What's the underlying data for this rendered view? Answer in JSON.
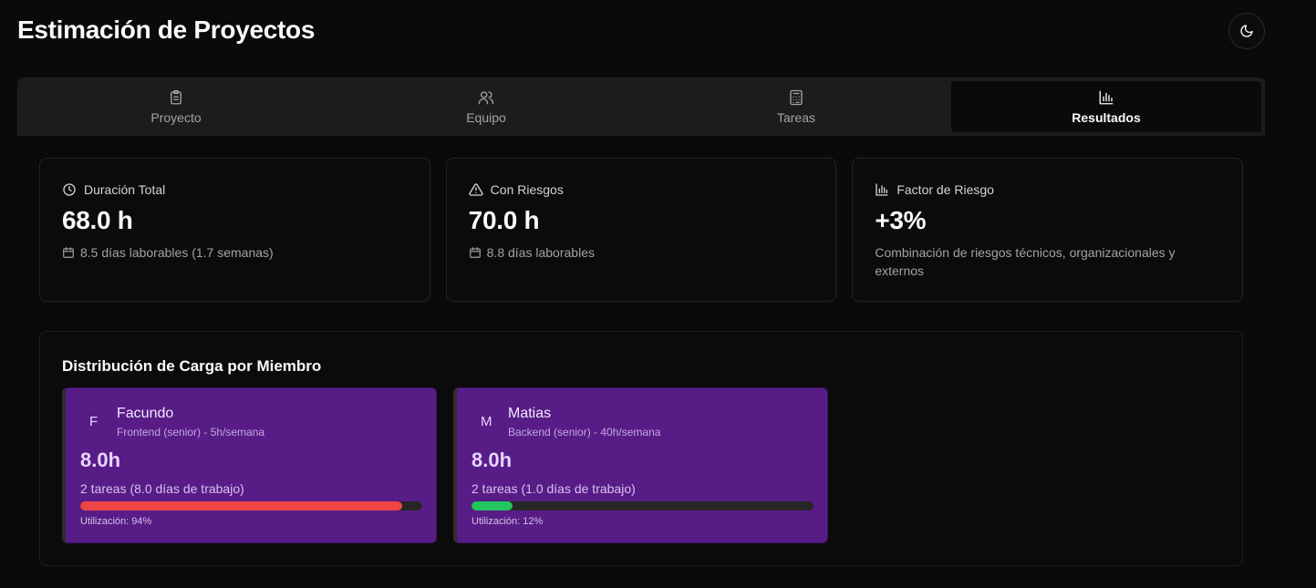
{
  "header": {
    "title": "Estimación de Proyectos",
    "theme_icon": "moon-icon"
  },
  "tabs": [
    {
      "label": "Proyecto",
      "icon": "clipboard-icon",
      "active": false
    },
    {
      "label": "Equipo",
      "icon": "users-icon",
      "active": false
    },
    {
      "label": "Tareas",
      "icon": "calculator-icon",
      "active": false
    },
    {
      "label": "Resultados",
      "icon": "bar-chart-icon",
      "active": true
    }
  ],
  "stats": [
    {
      "label": "Duración Total",
      "icon": "clock-icon",
      "value": "68.0 h",
      "sub_icon": "calendar-icon",
      "sub": "8.5 días laborables (1.7 semanas)"
    },
    {
      "label": "Con Riesgos",
      "icon": "warning-icon",
      "value": "70.0 h",
      "sub_icon": "calendar-icon",
      "sub": "8.8 días laborables"
    },
    {
      "label": "Factor de Riesgo",
      "icon": "bar-chart-icon",
      "value": "+3%",
      "sub": "Combinación de riesgos técnicos, organizacionales y externos"
    }
  ],
  "distribution": {
    "title": "Distribución de Carga por Miembro",
    "members": [
      {
        "initial": "F",
        "name": "Facundo",
        "role": "Frontend (senior) - 5h/semana",
        "hours": "8.0h",
        "tasks": "2 tareas (8.0 días de trabajo)",
        "utilization_label": "Utilización: 94%",
        "utilization": 0.94,
        "bar_color": "#ef4444"
      },
      {
        "initial": "M",
        "name": "Matias",
        "role": "Backend (senior) - 40h/semana",
        "hours": "8.0h",
        "tasks": "2 tareas (1.0 días de trabajo)",
        "utilization_label": "Utilización: 12%",
        "utilization": 0.12,
        "bar_color": "#22c55e"
      }
    ]
  },
  "colors": {
    "accent_card": "#581c87",
    "danger": "#ef4444",
    "success": "#22c55e"
  }
}
